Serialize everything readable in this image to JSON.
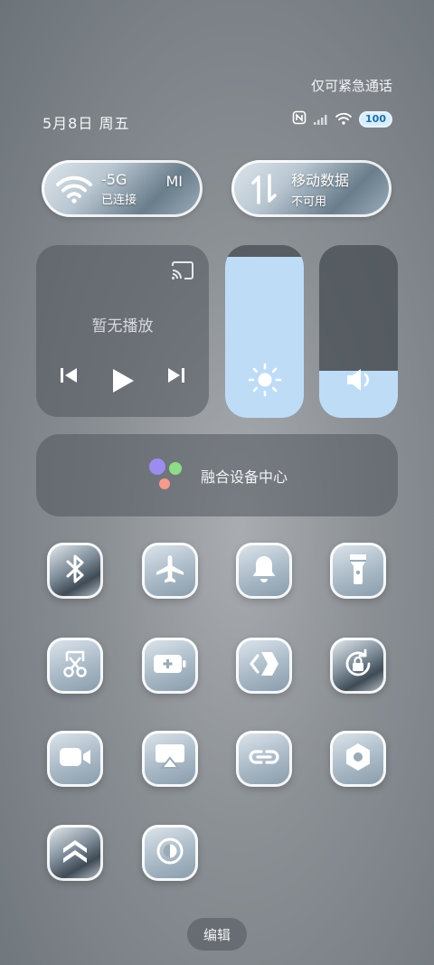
{
  "status_bar": {
    "carrier_text": "仅可紧急通话",
    "date": "5月8日 周五",
    "battery": "100"
  },
  "wifi_tile": {
    "title": "-5G",
    "extra": "MI",
    "subtitle": "已连接"
  },
  "data_tile": {
    "title": "移动数据",
    "subtitle": "不可用"
  },
  "media": {
    "title": "暂无播放"
  },
  "brightness": {
    "level": 0.93
  },
  "volume": {
    "level": 0.27
  },
  "hub": {
    "label": "融合设备中心"
  },
  "tiles": [
    {
      "icon": "bluetooth-icon"
    },
    {
      "icon": "airplane-icon"
    },
    {
      "icon": "bell-icon"
    },
    {
      "icon": "flashlight-icon"
    },
    {
      "icon": "screenshot-icon"
    },
    {
      "icon": "battery-saver-icon"
    },
    {
      "icon": "link-arrow-icon"
    },
    {
      "icon": "rotation-lock-icon"
    },
    {
      "icon": "screen-record-icon"
    },
    {
      "icon": "cast-screen-icon"
    },
    {
      "icon": "chain-link-icon"
    },
    {
      "icon": "settings-hex-icon"
    },
    {
      "icon": "double-chevron-up-icon"
    },
    {
      "icon": "dark-mode-icon"
    }
  ],
  "edit_button": {
    "label": "编辑"
  },
  "colors": {
    "slider_fill": "#bfdcf7",
    "battery_badge": "#d8eefc"
  }
}
